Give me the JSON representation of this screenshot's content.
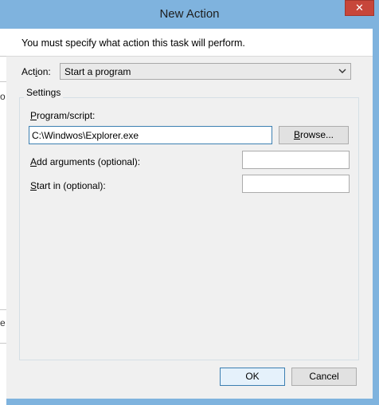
{
  "window": {
    "title": "New Action",
    "close_glyph": "✕"
  },
  "header": {
    "message": "You must specify what action this task will perform."
  },
  "action": {
    "label_mnemonic": "i",
    "label_pre": "Act",
    "label_post": "on:",
    "selected": "Start a program"
  },
  "settings": {
    "legend": "Settings",
    "program": {
      "label_mnemonic": "P",
      "label_rest": "rogram/script:",
      "value": "C:\\Windwos\\Explorer.exe"
    },
    "browse": {
      "label_mnemonic": "B",
      "label_rest": "rowse..."
    },
    "arguments": {
      "label_mnemonic": "A",
      "label_rest": "dd arguments (optional):",
      "value": ""
    },
    "start_in": {
      "label_mnemonic": "S",
      "label_rest": "tart in (optional):",
      "value": ""
    }
  },
  "footer": {
    "ok": "OK",
    "cancel": "Cancel"
  },
  "background": {
    "edge_chars": [
      "o",
      "e"
    ]
  }
}
